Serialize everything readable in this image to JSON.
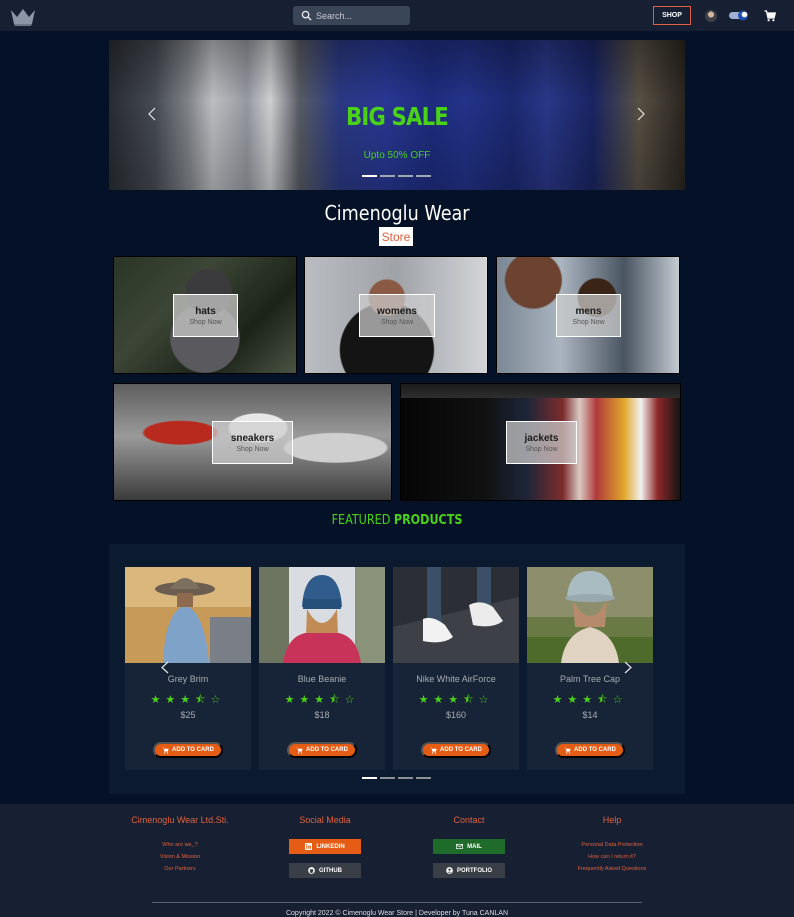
{
  "header": {
    "search_placeholder": "Search...",
    "shop_label": "SHOP",
    "icons": [
      "crown-logo-icon",
      "search-icon",
      "user-avatar",
      "theme-toggle-icon",
      "cart-icon"
    ]
  },
  "hero": {
    "title": "BIG SALE",
    "subtitle": "Upto 50% OFF",
    "slide_count": 4,
    "active_slide": 1
  },
  "brand": {
    "name": "Cimenoglu Wear",
    "badge": "Store"
  },
  "categories": [
    {
      "name": "hats",
      "cta": "Shop Now"
    },
    {
      "name": "womens",
      "cta": "Shop Now"
    },
    {
      "name": "mens",
      "cta": "Shop Now"
    },
    {
      "name": "sneakers",
      "cta": "Shop Now"
    },
    {
      "name": "jackets",
      "cta": "Shop Now"
    }
  ],
  "featured": {
    "title_light": "FEATURED",
    "title_bold": "PRODUCTS",
    "products": [
      {
        "name": "Grey Brim",
        "rating": 3.5,
        "stars": "★★★⯪☆",
        "price": "$25",
        "button": "ADD TO CARD"
      },
      {
        "name": "Blue Beanie",
        "rating": 3.5,
        "stars": "★★★⯪☆",
        "price": "$18",
        "button": "ADD TO CARD"
      },
      {
        "name": "Nike White AirForce",
        "rating": 3.5,
        "stars": "★★★⯪☆",
        "price": "$160",
        "button": "ADD TO CARD"
      },
      {
        "name": "Palm Tree Cap",
        "rating": 3.5,
        "stars": "★★★⯪☆",
        "price": "$14",
        "button": "ADD TO CARD"
      }
    ],
    "page_count": 4,
    "active_page": 1
  },
  "footer": {
    "company": {
      "title": "Cimenoglu Wear Ltd.Sti.",
      "links": [
        "Who are we_?",
        "Vision & Mission",
        "Our Partners"
      ]
    },
    "social": {
      "title": "Social Media",
      "linkedin": "LINKEDIN",
      "github": "GITHUB"
    },
    "contact": {
      "title": "Contact",
      "mail": "MAIL",
      "portfolio": "PORTFOLIO"
    },
    "help": {
      "title": "Help",
      "links": [
        "Personal Data Protection",
        "How can I return it?",
        "Frequently Asked Questions"
      ]
    },
    "copyright": "Copyright 2022 © Cimenoglu Wear Store | Developer by Tuna CANLAN",
    "colors": {
      "accent": "#e0603b",
      "linkedin": "#e55d14",
      "mail": "#1f6b2a",
      "dark_button": "#3a3f47"
    }
  },
  "colors": {
    "background": "#041127",
    "header": "#172033",
    "green": "#49d216",
    "orange": "#e55d14"
  }
}
